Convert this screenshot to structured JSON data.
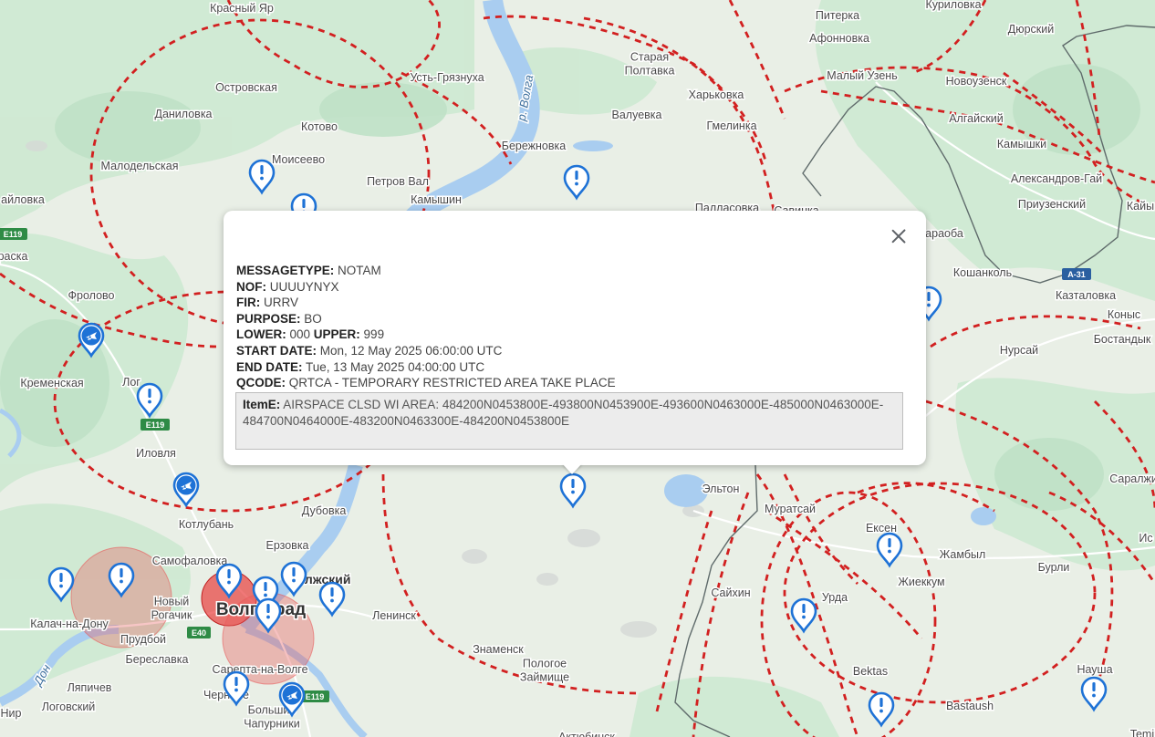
{
  "map": {
    "places": [
      {
        "id": "krasny-yar",
        "text": "Красный Яр"
      },
      {
        "id": "pitерka",
        "text": "Питерка"
      },
      {
        "id": "kurilovka",
        "text": "Куриловка"
      },
      {
        "id": "dyurskiy",
        "text": "Дюрский"
      },
      {
        "id": "afonovka",
        "text": "Афонновка"
      },
      {
        "id": "staraya-poltavka",
        "text": "Старая\nПолтавка"
      },
      {
        "id": "maly-uzen",
        "text": "Малый Узень"
      },
      {
        "id": "ust-gryaznukha",
        "text": "Усть-Грязнуха"
      },
      {
        "id": "ostrovskaya",
        "text": "Островская"
      },
      {
        "id": "novouzensk",
        "text": "Новоузенск"
      },
      {
        "id": "kharkovka",
        "text": "Харьковка"
      },
      {
        "id": "algaisky",
        "text": "Алгайский"
      },
      {
        "id": "danilovka",
        "text": "Даниловка"
      },
      {
        "id": "valuevka",
        "text": "Валуевка"
      },
      {
        "id": "gmelinka",
        "text": "Гмелинка"
      },
      {
        "id": "kotovo",
        "text": "Котово"
      },
      {
        "id": "kamyshki",
        "text": "Камышки"
      },
      {
        "id": "berezhnovka",
        "text": "Бережновка"
      },
      {
        "id": "moiseevo",
        "text": "Моисеево"
      },
      {
        "id": "malodelskaya",
        "text": "Малодельская"
      },
      {
        "id": "aleksandrov-gai",
        "text": "Александров-Гай"
      },
      {
        "id": "petrov-val",
        "text": "Петров Вал"
      },
      {
        "id": "ailovka",
        "text": "айловка"
      },
      {
        "id": "kamyshin",
        "text": "Камышин"
      },
      {
        "id": "priuzensky",
        "text": "Приузенский"
      },
      {
        "id": "pallasovka",
        "text": "Палласовка"
      },
      {
        "id": "savinka",
        "text": "Савинка"
      },
      {
        "id": "kaiy",
        "text": "Кайы"
      },
      {
        "id": "araoba",
        "text": "араоба"
      },
      {
        "id": "raska",
        "text": "раска"
      },
      {
        "id": "koshankol",
        "text": "Кошанколь"
      },
      {
        "id": "frolovo",
        "text": "Фролово"
      },
      {
        "id": "kaztalovka",
        "text": "Казталовка"
      },
      {
        "id": "konys",
        "text": "Коныс"
      },
      {
        "id": "nursay",
        "text": "Нурсай"
      },
      {
        "id": "bostandyk",
        "text": "Бостандык"
      },
      {
        "id": "kremenskaya",
        "text": "Кременская"
      },
      {
        "id": "log",
        "text": "Лог"
      },
      {
        "id": "ilovlya",
        "text": "Иловля"
      },
      {
        "id": "elton",
        "text": "Эльтон"
      },
      {
        "id": "saralzhin",
        "text": "Саралжин"
      },
      {
        "id": "muratsay",
        "text": "Муратсай"
      },
      {
        "id": "dubovka",
        "text": "Дубовка"
      },
      {
        "id": "kotluban",
        "text": "Котлубань"
      },
      {
        "id": "eksen",
        "text": "Ексен"
      },
      {
        "id": "erzovka",
        "text": "Ерзовка"
      },
      {
        "id": "zhambyl",
        "text": "Жамбыл"
      },
      {
        "id": "is",
        "text": "Ис"
      },
      {
        "id": "samofalovka",
        "text": "Самофаловка"
      },
      {
        "id": "volzhsky",
        "text": "Волжский"
      },
      {
        "id": "burli",
        "text": "Бурли"
      },
      {
        "id": "zhiekkum",
        "text": "Жиеккум"
      },
      {
        "id": "saikhin",
        "text": "Сайхин"
      },
      {
        "id": "volgograd",
        "text": "Волгоград"
      },
      {
        "id": "novy-rogachik",
        "text": "Новый\nРогачик"
      },
      {
        "id": "leninsk",
        "text": "Ленинск"
      },
      {
        "id": "urda",
        "text": "Урда"
      },
      {
        "id": "kalach",
        "text": "Калач-на-Дону"
      },
      {
        "id": "prudboy",
        "text": "Прудбой"
      },
      {
        "id": "znamensk",
        "text": "Знаменск"
      },
      {
        "id": "bereslavka",
        "text": "Береславка"
      },
      {
        "id": "sarepta",
        "text": "Сарепта-на-Волге"
      },
      {
        "id": "pologoe",
        "text": "Пологое\nЗаймище"
      },
      {
        "id": "bektas",
        "text": "Bektas"
      },
      {
        "id": "nausha",
        "text": "Науша"
      },
      {
        "id": "lyapichev",
        "text": "Ляпичев"
      },
      {
        "id": "chernoe",
        "text": "Черноое"
      },
      {
        "id": "logovsky",
        "text": "Логовский"
      },
      {
        "id": "bastaush",
        "text": "Bastaush"
      },
      {
        "id": "nir",
        "text": "Нир"
      },
      {
        "id": "bolshie-chapurniki",
        "text": "Большие\nЧапурники"
      },
      {
        "id": "aktyubinsk",
        "text": "Актюбинск"
      },
      {
        "id": "temir",
        "text": "Temir"
      }
    ],
    "rivers": [
      {
        "id": "r-volga",
        "text": "р. Волга"
      },
      {
        "id": "don",
        "text": "Дон"
      }
    ],
    "roads": [
      "E119",
      "E119",
      "E119",
      "E40",
      "E119",
      "A-31"
    ]
  },
  "popup": {
    "fields": [
      {
        "label": "MESSAGETYPE:",
        "value": " NOTAM"
      },
      {
        "label": "NOF:",
        "value": " UUUUYNYX"
      },
      {
        "label": "FIR:",
        "value": " URRV"
      },
      {
        "label": "PURPOSE:",
        "value": " BO"
      },
      {
        "label": "LOWER:",
        "value": " 000 ",
        "label2": "UPPER:",
        "value2": " 999"
      },
      {
        "label": "START DATE:",
        "value": " Mon, 12 May 2025 06:00:00 UTC"
      },
      {
        "label": "END DATE:",
        "value": " Tue, 13 May 2025 04:00:00 UTC"
      },
      {
        "label": "QCODE:",
        "value": " QRTCA - TEMPORARY RESTRICTED AREA TAKE PLACE"
      }
    ],
    "iteme": {
      "label": "ItemE:",
      "text": " AIRSPACE CLSD WI AREA: 484200N0453800E-493800N0453900E-493600N0463000E-485000N0463000E- 484700N0464000E-483200N0463300E-484200N0453800E"
    }
  },
  "colors": {
    "land": "#e9efe6",
    "green": "#cfe9d3",
    "water": "#a9cdf0",
    "dashed": "#d22020",
    "marker": "#1e72d6",
    "circle": "#e85b5b"
  }
}
